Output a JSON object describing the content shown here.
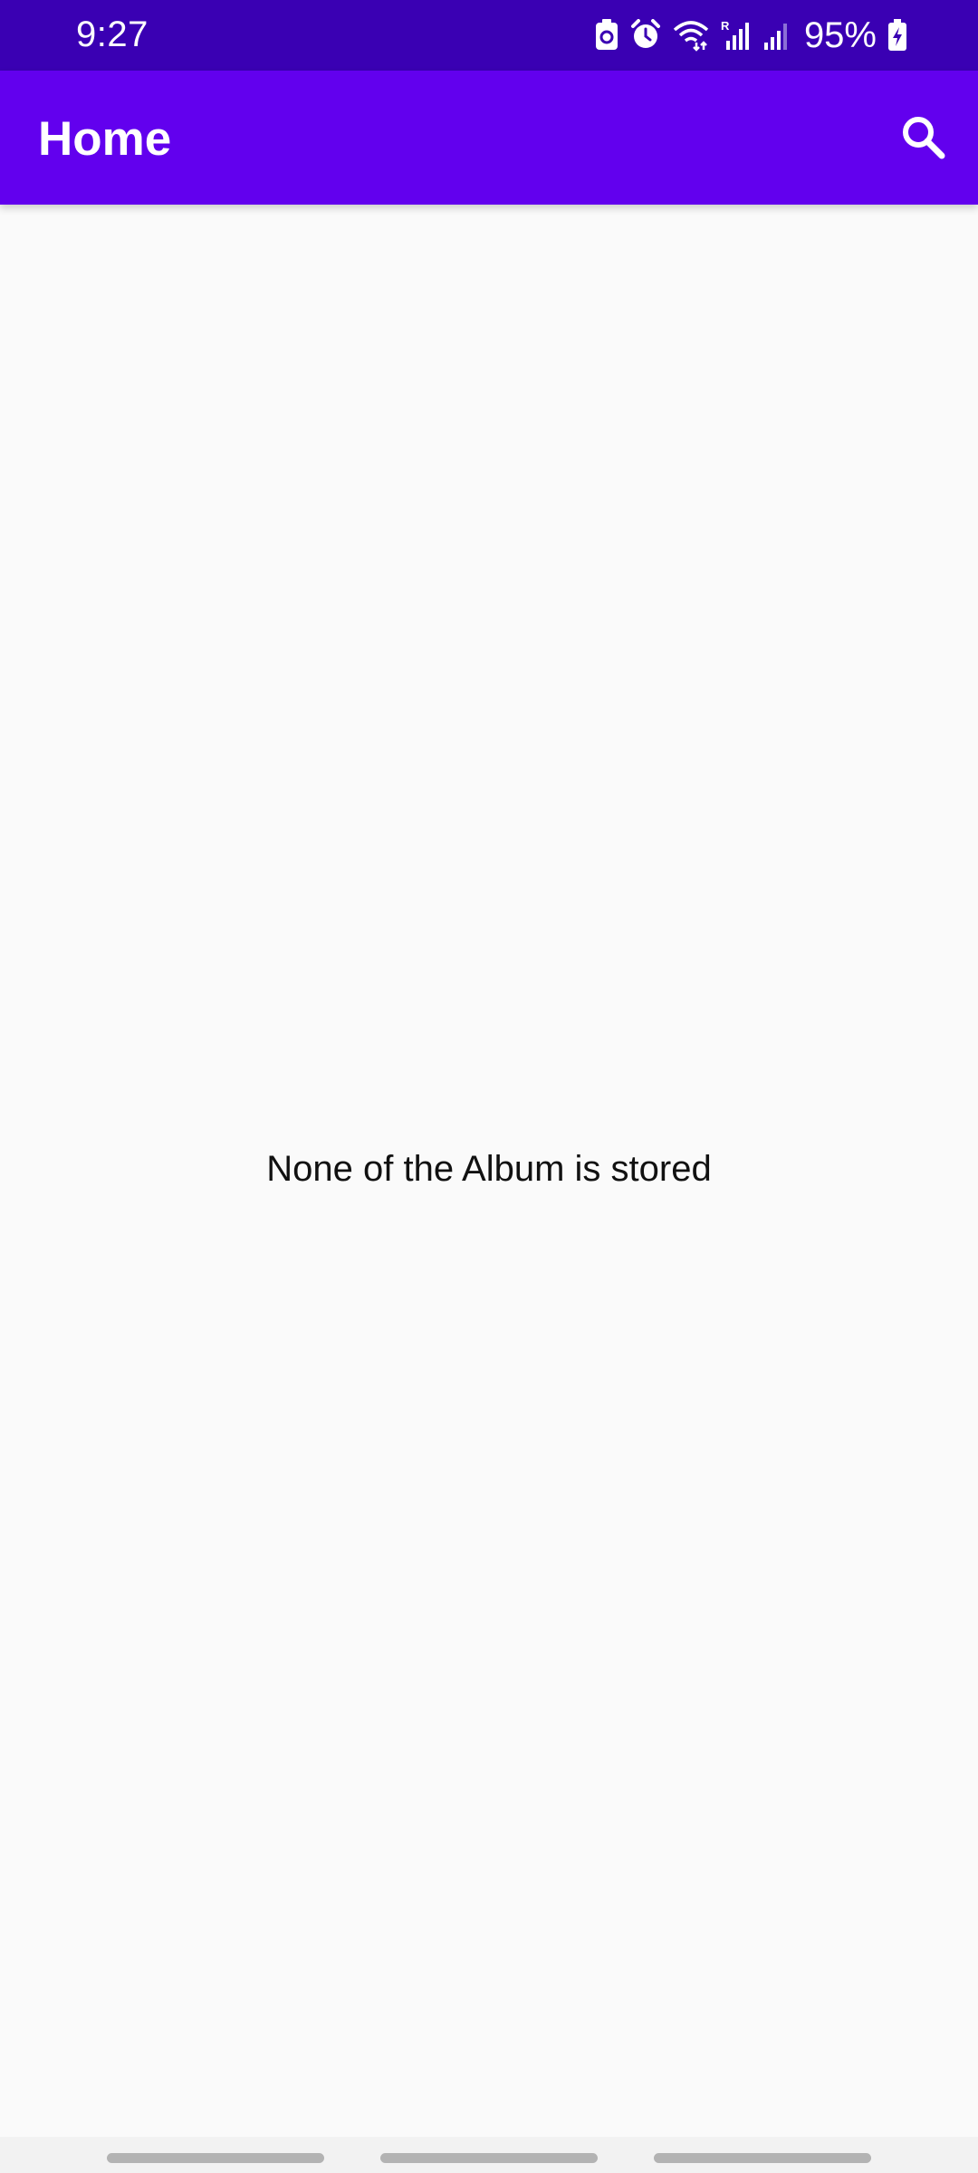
{
  "status_bar": {
    "time": "9:27",
    "battery": "95%",
    "icons": [
      "battery-saver-icon",
      "alarm-icon",
      "wifi-icon",
      "signal-r-icon",
      "signal-icon",
      "battery-charging-icon"
    ]
  },
  "app_bar": {
    "title": "Home",
    "search_icon": "search-icon"
  },
  "content": {
    "empty_message": "None of the Album is stored"
  },
  "colors": {
    "status_bar": "#3a00b3",
    "app_bar": "#6200ee",
    "background": "#fafafa"
  }
}
